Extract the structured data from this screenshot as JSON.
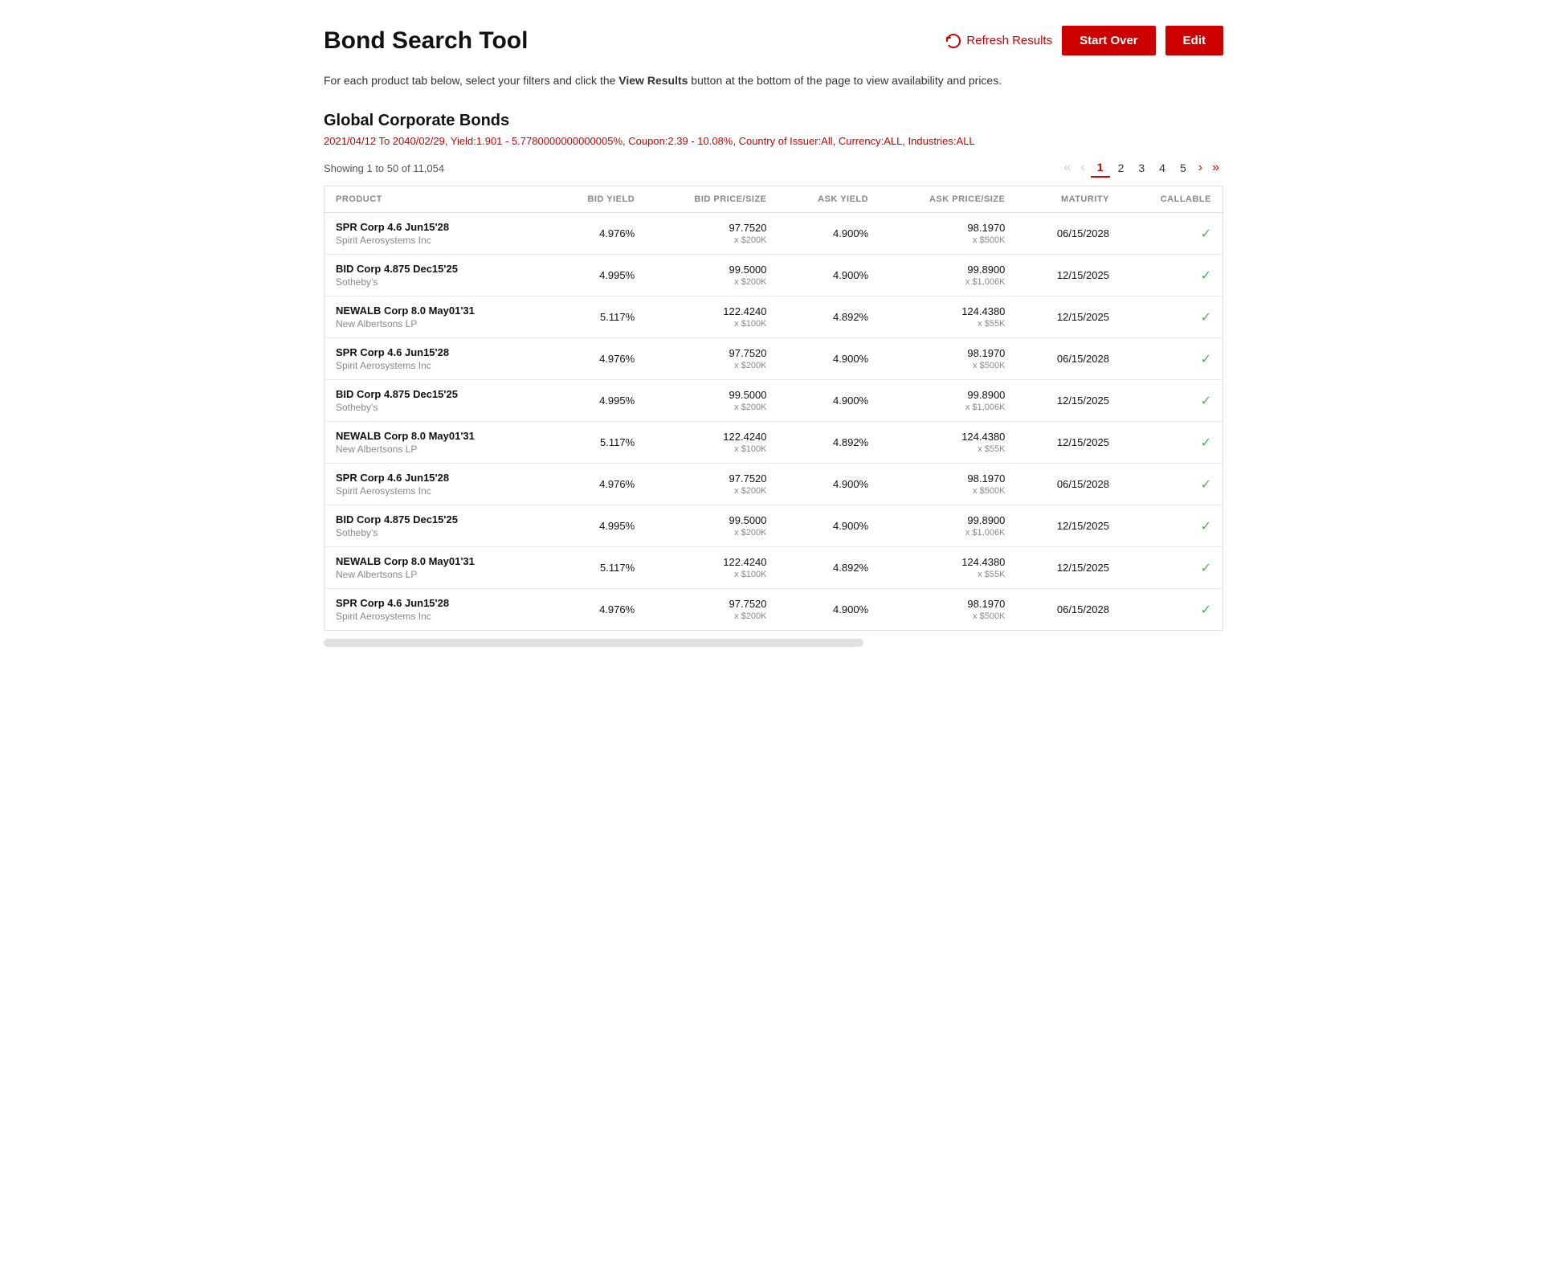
{
  "header": {
    "title": "Bond Search Tool",
    "refresh_label": "Refresh Results",
    "start_over_label": "Start Over",
    "edit_label": "Edit"
  },
  "subtitle": {
    "line1": "For each product tab below, select your filters and click the ",
    "bold": "View Results",
    "line2": " button at the bottom of the page to view availability and prices."
  },
  "section": {
    "title": "Global Corporate Bonds",
    "filter_summary": "2021/04/12 To 2040/02/29, Yield:1.901 - 5.7780000000000005%, Coupon:2.39 - 10.08%, Country of Issuer:All, Currency:ALL, Industries:ALL"
  },
  "results": {
    "showing_text": "Showing 1 to 50 of 11,054"
  },
  "pagination": {
    "pages": [
      "1",
      "2",
      "3",
      "4",
      "5"
    ],
    "active": "1"
  },
  "table": {
    "columns": [
      "PRODUCT",
      "BID YIELD",
      "BID PRICE/SIZE",
      "ASK YIELD",
      "ASK PRICE/SIZE",
      "MATURITY",
      "CALLABLE"
    ],
    "rows": [
      {
        "product_name": "SPR Corp 4.6 Jun15'28",
        "product_issuer": "Spirit Aerosystems Inc",
        "bid_yield": "4.976%",
        "bid_price": "97.7520",
        "bid_size": "x $200K",
        "ask_yield": "4.900%",
        "ask_price": "98.1970",
        "ask_size": "x $500K",
        "maturity": "06/15/2028",
        "callable": true
      },
      {
        "product_name": "BID Corp 4.875 Dec15'25",
        "product_issuer": "Sotheby's",
        "bid_yield": "4.995%",
        "bid_price": "99.5000",
        "bid_size": "x $200K",
        "ask_yield": "4.900%",
        "ask_price": "99.8900",
        "ask_size": "x $1,006K",
        "maturity": "12/15/2025",
        "callable": true
      },
      {
        "product_name": "NEWALB Corp 8.0 May01'31",
        "product_issuer": "New Albertsons LP",
        "bid_yield": "5.117%",
        "bid_price": "122.4240",
        "bid_size": "x $100K",
        "ask_yield": "4.892%",
        "ask_price": "124.4380",
        "ask_size": "x $55K",
        "maturity": "12/15/2025",
        "callable": true
      },
      {
        "product_name": "SPR Corp 4.6 Jun15'28",
        "product_issuer": "Spirit Aerosystems Inc",
        "bid_yield": "4.976%",
        "bid_price": "97.7520",
        "bid_size": "x $200K",
        "ask_yield": "4.900%",
        "ask_price": "98.1970",
        "ask_size": "x $500K",
        "maturity": "06/15/2028",
        "callable": true
      },
      {
        "product_name": "BID Corp 4.875 Dec15'25",
        "product_issuer": "Sotheby's",
        "bid_yield": "4.995%",
        "bid_price": "99.5000",
        "bid_size": "x $200K",
        "ask_yield": "4.900%",
        "ask_price": "99.8900",
        "ask_size": "x $1,006K",
        "maturity": "12/15/2025",
        "callable": true
      },
      {
        "product_name": "NEWALB Corp 8.0 May01'31",
        "product_issuer": "New Albertsons LP",
        "bid_yield": "5.117%",
        "bid_price": "122.4240",
        "bid_size": "x $100K",
        "ask_yield": "4.892%",
        "ask_price": "124.4380",
        "ask_size": "x $55K",
        "maturity": "12/15/2025",
        "callable": true
      },
      {
        "product_name": "SPR Corp 4.6 Jun15'28",
        "product_issuer": "Spirit Aerosystems Inc",
        "bid_yield": "4.976%",
        "bid_price": "97.7520",
        "bid_size": "x $200K",
        "ask_yield": "4.900%",
        "ask_price": "98.1970",
        "ask_size": "x $500K",
        "maturity": "06/15/2028",
        "callable": true
      },
      {
        "product_name": "BID Corp 4.875 Dec15'25",
        "product_issuer": "Sotheby's",
        "bid_yield": "4.995%",
        "bid_price": "99.5000",
        "bid_size": "x $200K",
        "ask_yield": "4.900%",
        "ask_price": "99.8900",
        "ask_size": "x $1,006K",
        "maturity": "12/15/2025",
        "callable": true
      },
      {
        "product_name": "NEWALB Corp 8.0 May01'31",
        "product_issuer": "New Albertsons LP",
        "bid_yield": "5.117%",
        "bid_price": "122.4240",
        "bid_size": "x $100K",
        "ask_yield": "4.892%",
        "ask_price": "124.4380",
        "ask_size": "x $55K",
        "maturity": "12/15/2025",
        "callable": true
      },
      {
        "product_name": "SPR Corp 4.6 Jun15'28",
        "product_issuer": "Spirit Aerosystems Inc",
        "bid_yield": "4.976%",
        "bid_price": "97.7520",
        "bid_size": "x $200K",
        "ask_yield": "4.900%",
        "ask_price": "98.1970",
        "ask_size": "x $500K",
        "maturity": "06/15/2028",
        "callable": true
      }
    ]
  }
}
